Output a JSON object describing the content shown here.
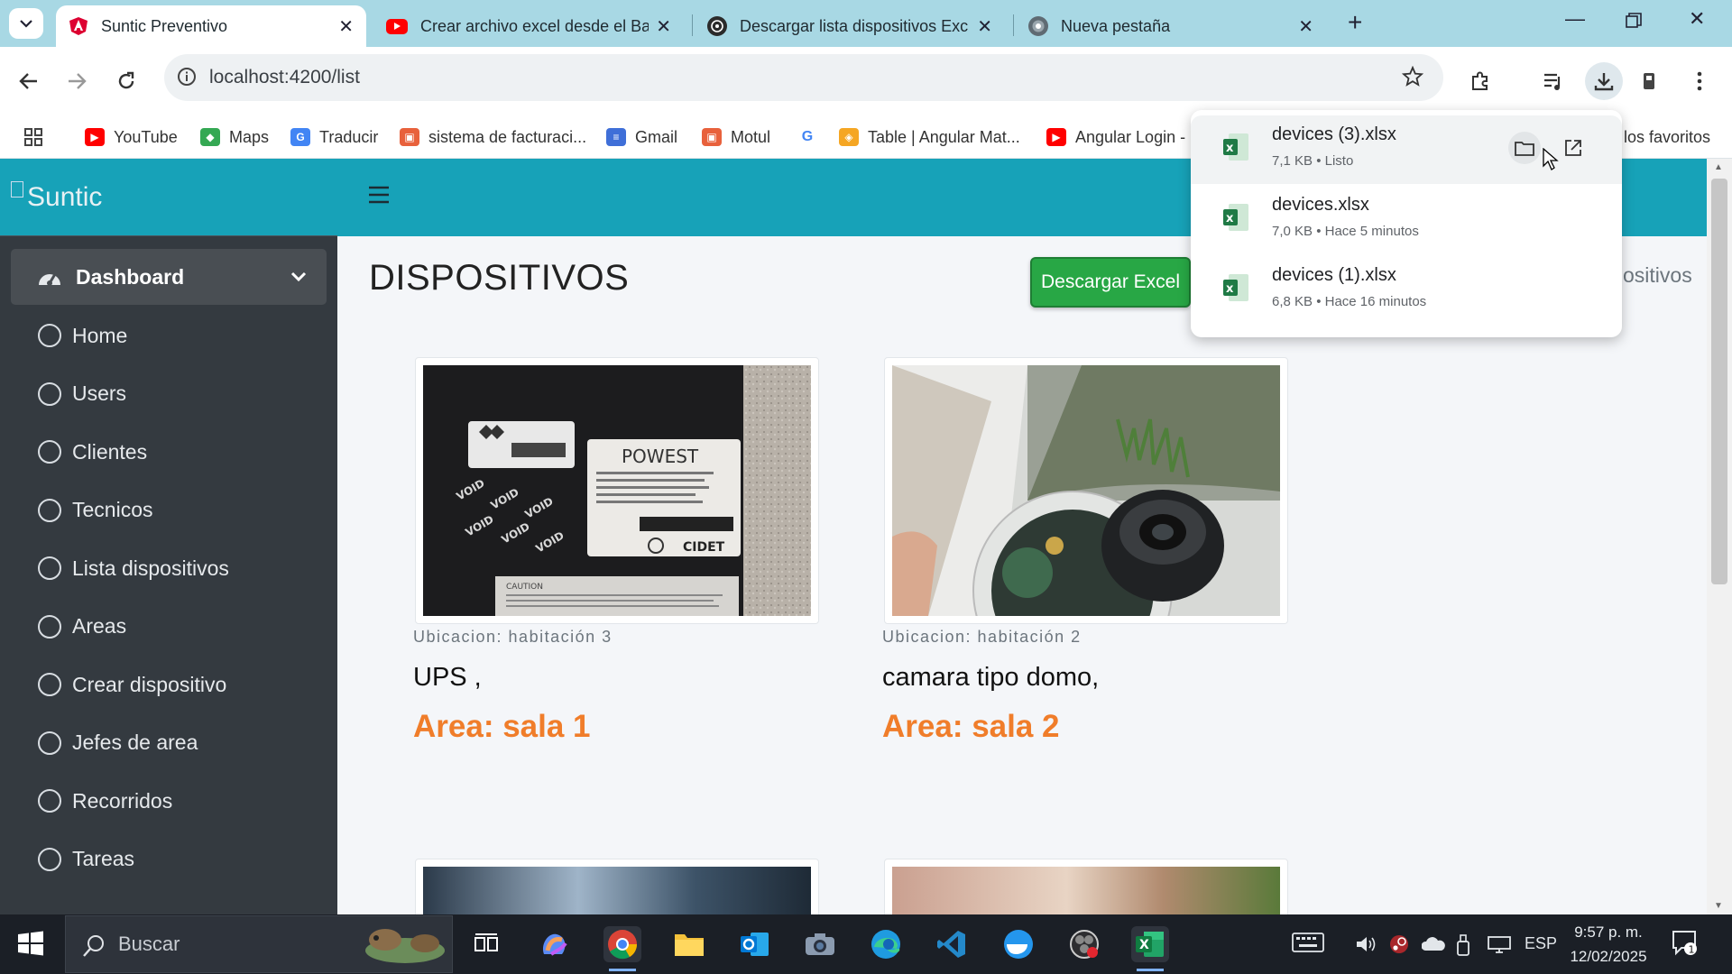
{
  "browser": {
    "tabs": [
      {
        "title": "Suntic Preventivo",
        "active": true
      },
      {
        "title": "Crear archivo excel desde el Ba"
      },
      {
        "title": "Descargar lista dispositivos Exc"
      },
      {
        "title": "Nueva pestaña"
      }
    ],
    "url": "localhost:4200/list",
    "bookmarks": [
      "YouTube",
      "Maps",
      "Traducir",
      "sistema de facturaci...",
      "Gmail",
      "Motul",
      "",
      "Table | Angular Mat...",
      "Angular Login -"
    ],
    "bookmarks_overflow": "los favoritos"
  },
  "app": {
    "brand": "Suntic",
    "sidebar": {
      "dashboard": "Dashboard",
      "items": [
        "Home",
        "Users",
        "Clientes",
        "Tecnicos",
        "Lista dispositivos",
        "Areas",
        "Crear dispositivo",
        "Jefes de area",
        "Recorridos",
        "Tareas"
      ]
    },
    "page_title": "DISPOSITIVOS",
    "download_button": "Descargar Excel",
    "breadcrumb_fragment": "ositivos",
    "devices": [
      {
        "location": "Ubicacion: habitación 3",
        "name": "UPS ,",
        "area": "Area: sala 1",
        "label_brand": "POWEST",
        "label_cert": "CIDET",
        "label_warning": "CAUTION"
      },
      {
        "location": "Ubicacion: habitación 2",
        "name": "camara tipo domo,",
        "area": "Area: sala 2"
      }
    ]
  },
  "downloads": [
    {
      "file": "devices (3).xlsx",
      "info": "7,1 KB • Listo"
    },
    {
      "file": "devices.xlsx",
      "info": "7,0 KB • Hace 5 minutos"
    },
    {
      "file": "devices (1).xlsx",
      "info": "6,8 KB • Hace 16 minutos"
    }
  ],
  "taskbar": {
    "search_placeholder": "Buscar",
    "language": "ESP",
    "time": "9:57 p. m.",
    "date": "12/02/2025"
  },
  "colors": {
    "accent": "#17a2b8",
    "sidebar": "#343a40",
    "button_green": "#28a745",
    "area_orange": "#f07d2a"
  }
}
